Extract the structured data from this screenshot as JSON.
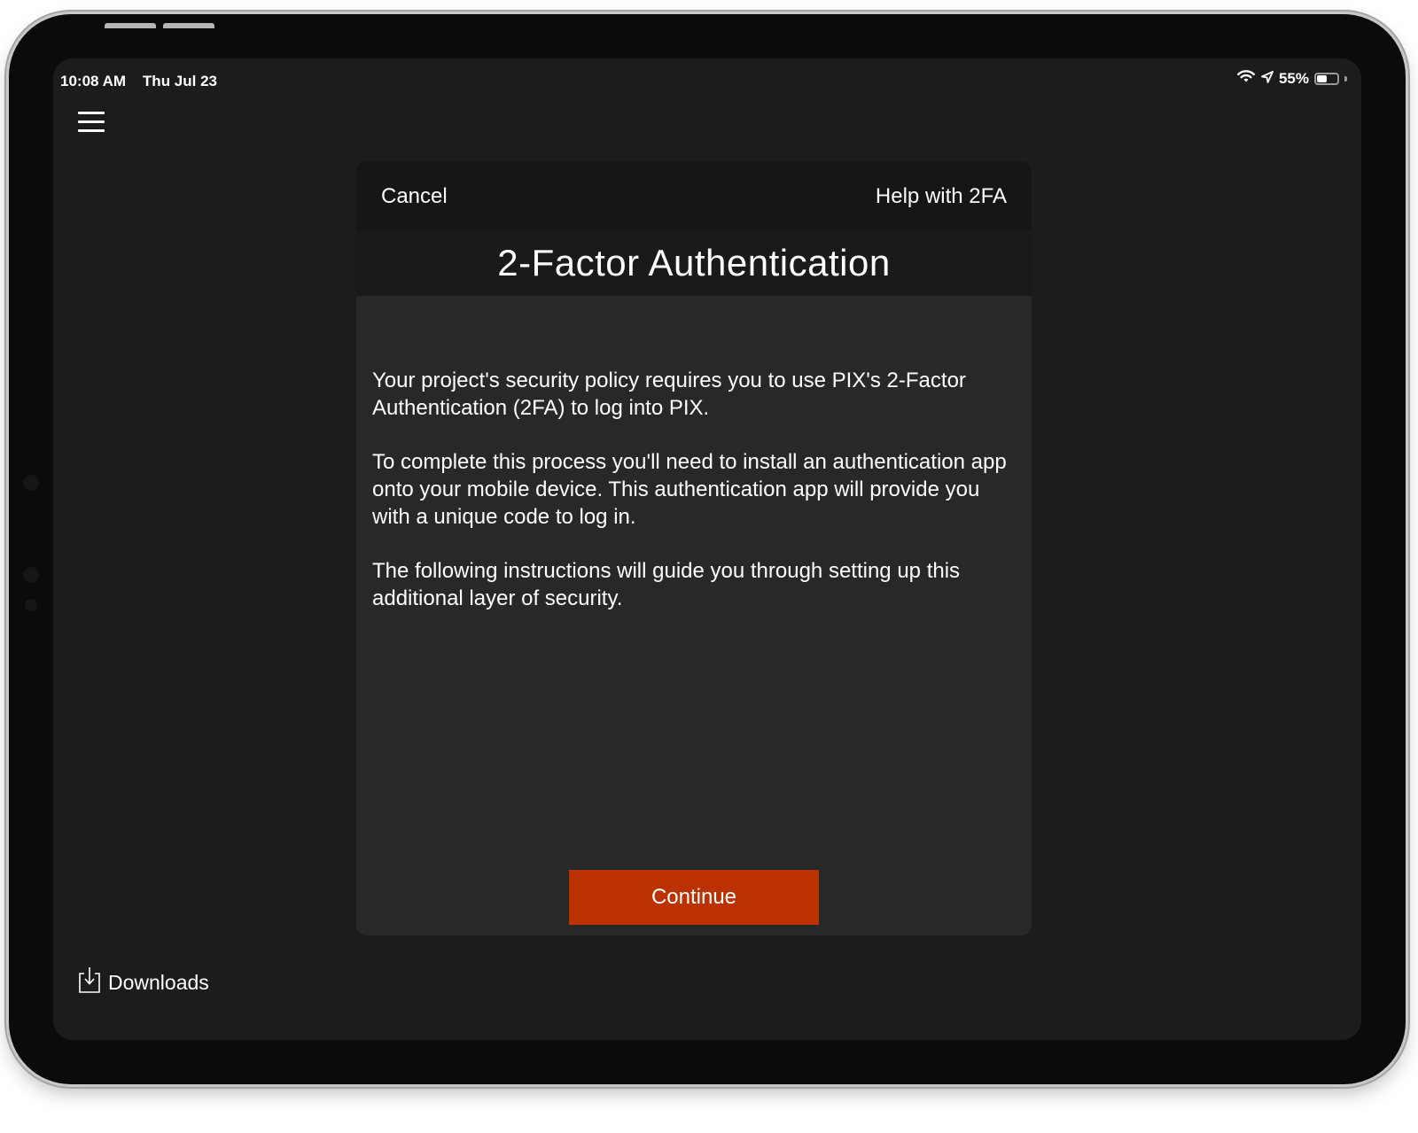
{
  "status_bar": {
    "time": "10:08 AM",
    "date": "Thu Jul 23",
    "battery_percent": "55%",
    "battery_level": 0.55,
    "icons": [
      "wifi-icon",
      "location-arrow-icon",
      "battery-icon"
    ]
  },
  "sidebar": {
    "menu_icon": "hamburger-menu-icon",
    "downloads_label": "Downloads",
    "downloads_icon": "download-tray-icon"
  },
  "dialog": {
    "cancel_label": "Cancel",
    "help_label": "Help with 2FA",
    "title": "2-Factor Authentication",
    "paragraphs": [
      "Your project's security policy requires you to use PIX's 2-Factor Authentication (2FA) to log into PIX.",
      "To complete this process you'll need to install an authentication app onto your mobile device. This authentication app will provide you with a unique code to log in.",
      "The following instructions will guide you through setting up this additional layer of security."
    ],
    "continue_label": "Continue"
  },
  "colors": {
    "accent": "#bb3100",
    "screen_background": "#1c1c1c",
    "dialog_background": "#282828",
    "nav_background": "#161616",
    "text": "#ffffff"
  }
}
